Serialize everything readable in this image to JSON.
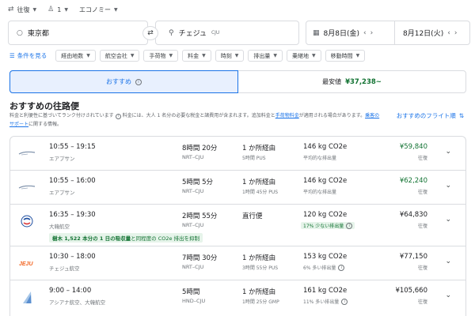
{
  "topbar": {
    "trip_type": "往復",
    "passengers": "1",
    "cabin": "エコノミー"
  },
  "search": {
    "origin": "東京都",
    "destination": "チェジュ",
    "destination_code": "CJU",
    "depart_date": "8月8日(金)",
    "return_date": "8月12日(火)"
  },
  "filters": {
    "all_label": "条件を見る",
    "chips": [
      "経由地数",
      "航空会社",
      "手荷物",
      "料金",
      "時刻",
      "排出量",
      "乗継地",
      "移動時間"
    ]
  },
  "tabs": {
    "recommended": "おすすめ",
    "cheapest_label": "最安値",
    "cheapest_price": "¥37,238~"
  },
  "section": {
    "title": "おすすめの往路便",
    "desc_line1": "料金と利便性に基づいてランク付けされています",
    "desc_line1_cont": "料金には、大人 1 名分の必要な税金と諸費用が含まれます。追加料金と",
    "desc_link1": "手荷物料金",
    "desc_line1_end": "が適用される場合があります。",
    "desc_link2": "乗客のサポート",
    "desc_line2_end": "に関する情報。",
    "sort_link": "おすすめのフライト順"
  },
  "flights": [
    {
      "times": "10:55 – 19:15",
      "airline": "エアプサン",
      "duration": "8時間 20分",
      "route": "NRT–CJU",
      "stops": "1 か所経由",
      "stop_detail": "5時間 PUS",
      "co2": "146 kg CO2e",
      "co2_note": "平均的な排出量",
      "price": "¥59,840",
      "price_type": "往復"
    },
    {
      "times": "10:55 – 16:00",
      "airline": "エアプサン",
      "duration": "5時間 5分",
      "route": "NRT–CJU",
      "stops": "1 か所経由",
      "stop_detail": "1時間 45分 PUS",
      "co2": "146 kg CO2e",
      "co2_note": "平均的な排出量",
      "price": "¥62,240",
      "price_type": "往復"
    },
    {
      "times": "16:35 – 19:30",
      "airline": "大韓航空",
      "duration": "2時間 55分",
      "route": "NRT–CJU",
      "stops": "直行便",
      "stop_detail": "",
      "co2": "120 kg CO2e",
      "co2_note": "17% 少ない排出量",
      "price": "¥64,830",
      "price_type": "往復",
      "banner_bold": "樹木 1,522 本分の 1 日の吸収量",
      "banner_rest": "と同程度の CO2e 排出を抑制"
    },
    {
      "times": "10:30 – 18:00",
      "airline": "チェジュ航空",
      "duration": "7時間 30分",
      "route": "NRT–CJU",
      "stops": "1 か所経由",
      "stop_detail": "3時間 55分 PUS",
      "co2": "153 kg CO2e",
      "co2_note": "6% 多い排出量",
      "price": "¥77,150",
      "price_type": "往復"
    },
    {
      "times": "9:00 – 14:00",
      "airline": "アシアナ航空、大韓航空",
      "duration": "5時間",
      "route": "HND–CJU",
      "stops": "1 か所経由",
      "stop_detail": "1時間 25分 GMP",
      "co2": "161 kg CO2e",
      "co2_note": "11% 多い排出量",
      "price": "¥105,660",
      "price_type": "往復"
    }
  ]
}
